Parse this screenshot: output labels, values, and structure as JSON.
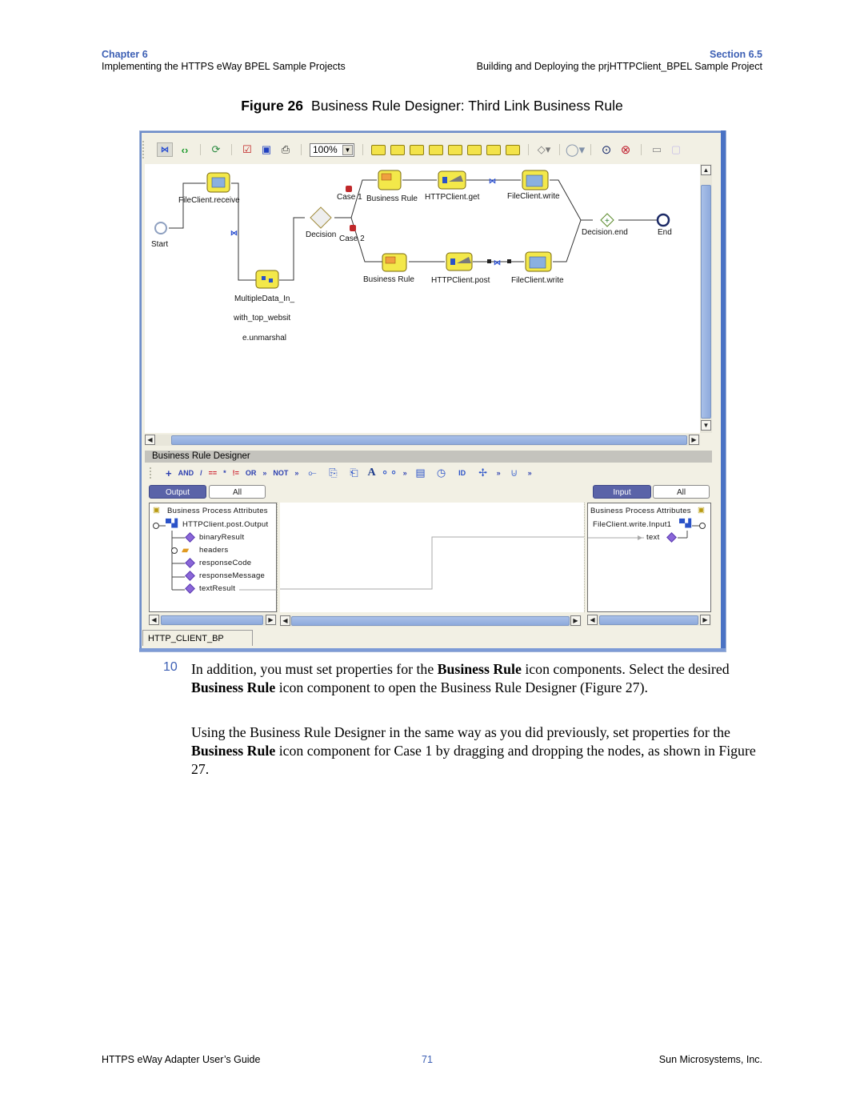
{
  "header": {
    "chapter": "Chapter 6",
    "chapter_title": "Implementing the HTTPS eWay BPEL Sample Projects",
    "section": "Section 6.5",
    "section_title": "Building and Deploying the prjHTTPClient_BPEL Sample Project"
  },
  "figure": {
    "label": "Figure 26",
    "title": "Business Rule Designer: Third Link Business Rule"
  },
  "screenshot": {
    "toolbar": {
      "zoom_value": "100%",
      "icons": [
        "bpel-map-icon",
        "source-code-icon",
        "sync-icon",
        "validate-icon",
        "monitor-icon",
        "print-icon",
        "zoom-dropdown",
        "receive-icon",
        "reply-icon",
        "invoke-icon",
        "assign-icon",
        "wait-icon",
        "business-rule-icon",
        "timer-icon",
        "catch-icon",
        "decision-icon",
        "event-icon",
        "compensate-icon",
        "terminate-icon",
        "scope-icon",
        "empty-icon"
      ]
    },
    "diagram": {
      "nodes": {
        "start": "Start",
        "file_receive": "FileClient.receive",
        "multiple_data_1": "MultipleData_In_",
        "multiple_data_2": "with_top_websit",
        "multiple_data_3": "e.unmarshal",
        "decision": "Decision",
        "case1": "Case 1",
        "case2": "Case 2",
        "business_rule_1": "Business Rule",
        "business_rule_2": "Business Rule",
        "http_get": "HTTPClient.get",
        "http_post": "HTTPClient.post",
        "file_write_1": "FileClient.write",
        "file_write_2": "FileClient.write",
        "decision_end": "Decision.end",
        "end": "End"
      }
    },
    "business_rule_designer": {
      "title": "Business Rule Designer",
      "toolbar": [
        "+",
        "AND",
        "/",
        "==",
        "*",
        "!=",
        "OR",
        "»",
        "NOT",
        "»",
        "A",
        "»",
        "»",
        "»"
      ],
      "output_tabs": [
        {
          "label": "Output",
          "active": true
        },
        {
          "label": "All",
          "active": false
        }
      ],
      "input_tabs": [
        {
          "label": "Input",
          "active": true
        },
        {
          "label": "All",
          "active": false
        }
      ],
      "output_tree": {
        "root": "Business Process Attributes",
        "node": "HTTPClient.post.Output",
        "children": [
          "binaryResult",
          "headers",
          "responseCode",
          "responseMessage",
          "textResult"
        ]
      },
      "input_tree": {
        "root": "Business Process Attributes",
        "node": "FileClient.write.Input1",
        "children": [
          "text"
        ]
      },
      "mapping": {
        "from": "textResult",
        "to": "text"
      }
    },
    "bottom_tab": "HTTP_CLIENT_BP"
  },
  "content": {
    "step_number": "10",
    "para1_a": "In addition, you must set properties for the ",
    "para1_b": "Business Rule",
    "para1_c": " icon components. Select the desired ",
    "para1_d": "Business Rule",
    "para1_e": " icon component to open the Business Rule Designer (Figure 27).",
    "para2_a": "Using the Business Rule Designer in the same way as you did previously, set properties for the ",
    "para2_b": "Business Rule",
    "para2_c": " icon component for Case 1 by dragging and dropping the nodes, as shown in Figure 27."
  },
  "footer": {
    "left": "HTTPS eWay Adapter User’s Guide",
    "page": "71",
    "right": "Sun Microsystems, Inc."
  }
}
